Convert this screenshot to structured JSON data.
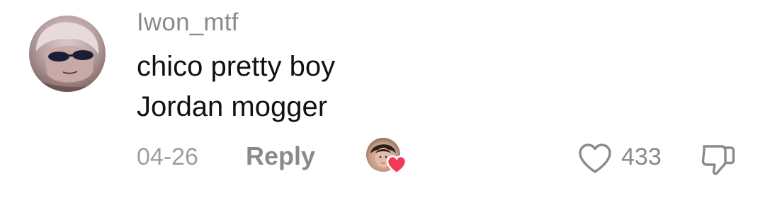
{
  "comment": {
    "username": "Iwon_mtf",
    "text_lines": [
      "chico pretty boy",
      "Jordan mogger"
    ],
    "date": "04-26",
    "reply_label": "Reply",
    "like_count": "433",
    "creator_liked": true
  },
  "icons": {
    "avatar": "user-avatar",
    "creator_avatar": "creator-avatar",
    "creator_heart": "heart-filled-icon",
    "like": "heart-outline-icon",
    "dislike": "thumbs-down-icon"
  },
  "colors": {
    "username": "#8a8a8a",
    "text": "#111111",
    "meta": "#9e9e9e",
    "heart_red": "#f23a56"
  }
}
